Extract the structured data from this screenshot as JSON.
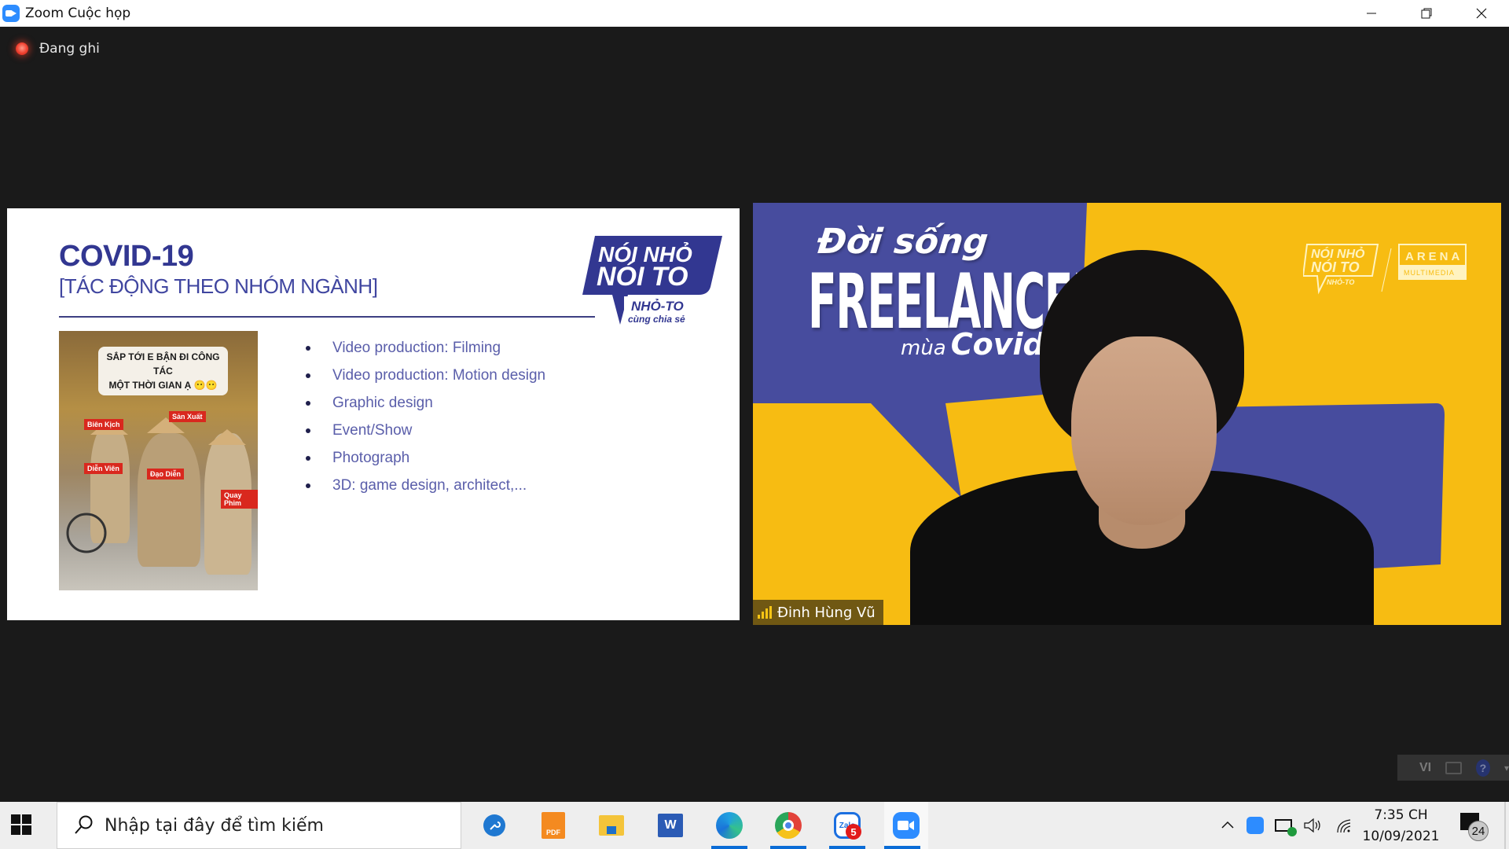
{
  "window": {
    "title": "Zoom Cuộc họp",
    "controls": {
      "minimize": "minimize-icon",
      "restore": "restore-icon",
      "close": "close-icon"
    }
  },
  "recording": {
    "label": "Đang ghi",
    "color": "#f0402f"
  },
  "slide": {
    "title": "COVID-19",
    "subtitle": "[TÁC ĐỘNG THEO NHÓM NGÀNH]",
    "logo": {
      "line1": "NÓI NHỎ",
      "line2": "NÓI TO",
      "line3": "NHỎ-TO",
      "line4": "cùng chia sẻ"
    },
    "photo": {
      "caption_line1": "SẮP TỚI E BẬN ĐI CÔNG TÁC",
      "caption_line2": "MỘT THỜI GIAN Ạ 😶😶",
      "tags": [
        "Biên Kịch",
        "Sản Xuất",
        "Diễn Viên",
        "Đạo Diễn",
        "Quay Phim"
      ]
    },
    "bullets": [
      "Video production: Filming",
      "Video production: Motion design",
      "Graphic design",
      "Event/Show",
      "Photograph",
      "3D: game design, architect,..."
    ],
    "accent_color": "#323791"
  },
  "video": {
    "title_line1": "Đời sống",
    "title_line2": "FREELANCER",
    "title_small": "mùa",
    "title_big": "Covid",
    "logo_left_1": "NÓI NHỎ",
    "logo_left_2": "NÓI TO",
    "logo_left_3": "NHỎ-TO",
    "logo_right_1": "ARENA",
    "logo_right_2": "MULTIMEDIA",
    "participant_name": "Đinh Hùng Vũ",
    "colors": {
      "yellow": "#f7bc12",
      "blue": "#474c9e"
    }
  },
  "ime": {
    "lang": "VI",
    "help": "?"
  },
  "taskbar": {
    "search_placeholder": "Nhập tại đây để tìm kiếm",
    "apps": [
      {
        "name": "Tool",
        "icon": "wrench-icon"
      },
      {
        "name": "Foxit PDF",
        "icon": "pdf-icon",
        "label": "PDF"
      },
      {
        "name": "File Explorer",
        "icon": "folder-icon"
      },
      {
        "name": "Word",
        "icon": "word-icon",
        "label": "W"
      },
      {
        "name": "Edge",
        "icon": "edge-icon"
      },
      {
        "name": "Chrome",
        "icon": "chrome-icon"
      },
      {
        "name": "Zalo",
        "icon": "zalo-icon",
        "label": "Zalo",
        "badge": "5"
      },
      {
        "name": "Zoom",
        "icon": "zoom-icon"
      }
    ],
    "clock_time": "7:35 CH",
    "clock_date": "10/09/2021",
    "notification_count": "24"
  }
}
